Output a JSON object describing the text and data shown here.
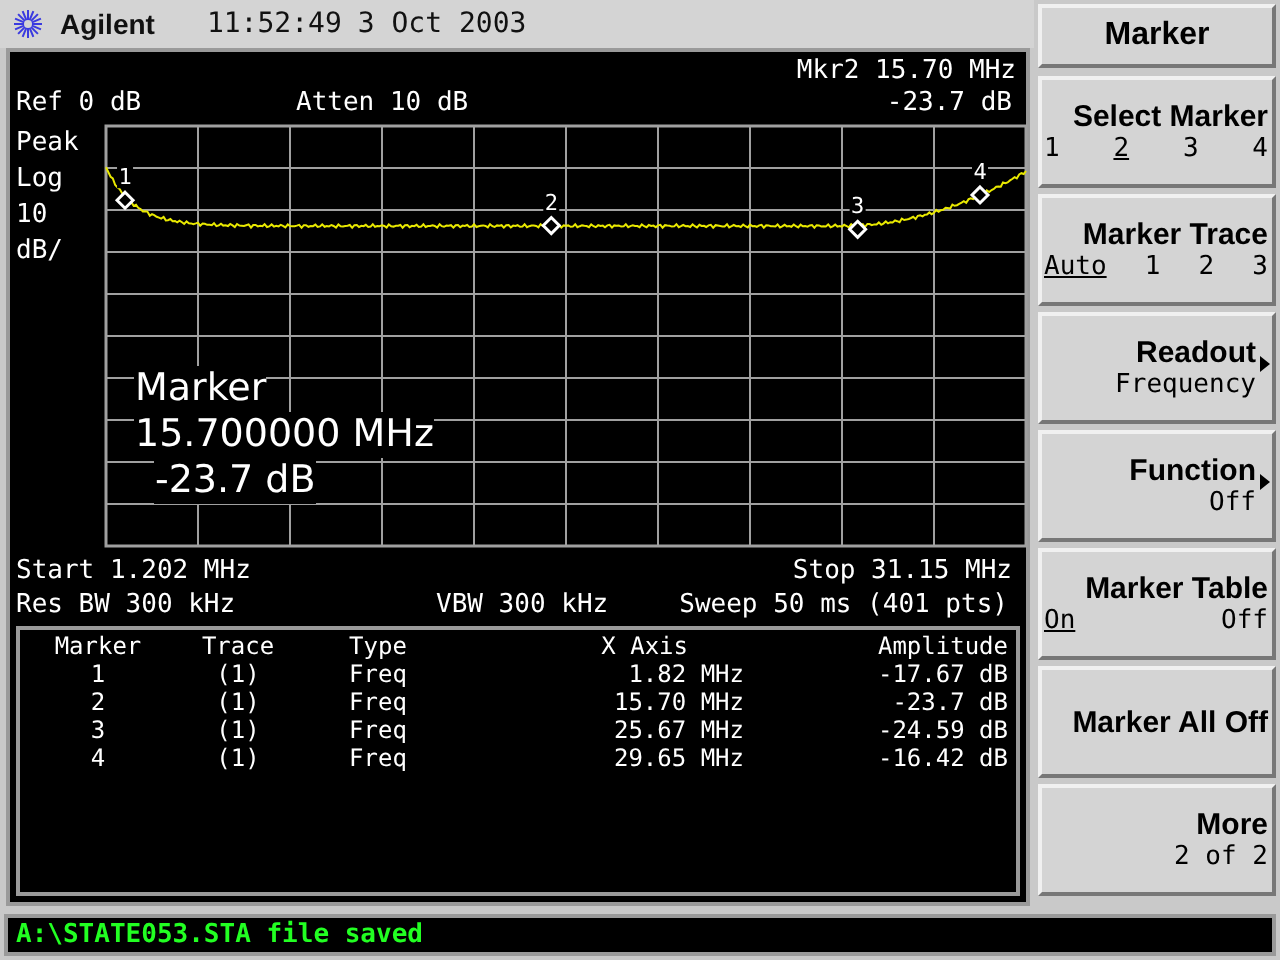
{
  "header": {
    "brand": "Agilent",
    "time": "11:52:49",
    "date": "3 Oct 2003"
  },
  "screen": {
    "marker_readout_top": "Mkr2 15.70 MHz",
    "ref": "Ref 0 dB",
    "atten": "Atten 10 dB",
    "marker_amplitude_top": "-23.7 dB",
    "scale_labels": [
      "Peak",
      "Log",
      "10",
      "dB/"
    ],
    "graph": {
      "markers": [
        {
          "label": "1"
        },
        {
          "label": "2"
        },
        {
          "label": "3"
        },
        {
          "label": "4"
        }
      ],
      "readout": [
        "Marker",
        "15.700000 MHz",
        "-23.7 dB"
      ]
    },
    "start": "Start 1.202 MHz",
    "stop": "Stop 31.15 MHz",
    "res_bw": "Res BW 300 kHz",
    "vbw": "VBW 300 kHz",
    "sweep": "Sweep 50 ms (401 pts)",
    "table": {
      "columns": [
        "Marker",
        "Trace",
        "Type",
        "X Axis",
        "Amplitude"
      ],
      "rows": [
        [
          "1",
          "(1)",
          "Freq",
          "1.82 MHz",
          "-17.67 dB"
        ],
        [
          "2",
          "(1)",
          "Freq",
          "15.70 MHz",
          "-23.7 dB"
        ],
        [
          "3",
          "(1)",
          "Freq",
          "25.67 MHz",
          "-24.59 dB"
        ],
        [
          "4",
          "(1)",
          "Freq",
          "29.65 MHz",
          "-16.42 dB"
        ]
      ]
    }
  },
  "menu": {
    "title": "Marker",
    "softkeys": [
      {
        "kind": "options",
        "label": "Select Marker",
        "submenu": false,
        "options": [
          {
            "label": "1",
            "selected": false
          },
          {
            "label": "2",
            "selected": true
          },
          {
            "label": "3",
            "selected": false
          },
          {
            "label": "4",
            "selected": false
          }
        ]
      },
      {
        "kind": "options",
        "label": "Marker Trace",
        "submenu": false,
        "options": [
          {
            "label": "Auto",
            "selected": true
          },
          {
            "label": "1",
            "selected": false
          },
          {
            "label": "2",
            "selected": false
          },
          {
            "label": "3",
            "selected": false
          }
        ]
      },
      {
        "kind": "value",
        "label": "Readout",
        "submenu": true,
        "value": "Frequency"
      },
      {
        "kind": "value",
        "label": "Function",
        "submenu": true,
        "value": "Off"
      },
      {
        "kind": "options",
        "label": "Marker Table",
        "submenu": false,
        "options": [
          {
            "label": "On",
            "selected": true
          },
          {
            "label": "Off",
            "selected": false
          }
        ]
      },
      {
        "kind": "plain",
        "label": "Marker All Off",
        "submenu": false
      },
      {
        "kind": "value",
        "label": "More",
        "submenu": false,
        "value": "2 of 2"
      }
    ]
  },
  "status_bar": {
    "message": "A:\\STATE053.STA file saved"
  }
}
